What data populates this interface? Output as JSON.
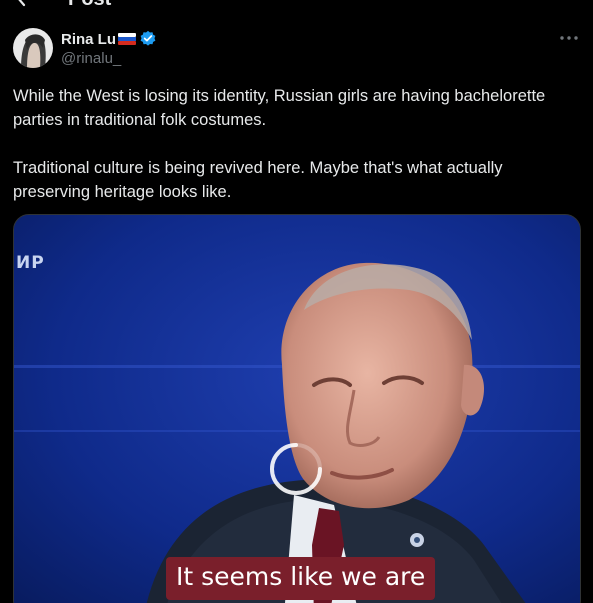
{
  "header": {
    "title": "Post"
  },
  "author": {
    "name": "Rina Lu",
    "handle": "@rinalu_",
    "flag_icon": "russia-flag-icon",
    "verified_icon": "verified-badge-icon"
  },
  "post": {
    "paragraphs": [
      "While the West is losing its identity, Russian girls are having bachelorette parties in traditional folk costumes.",
      "Traditional culture is being revived here. Maybe that's what actually preserving heritage looks like."
    ]
  },
  "media": {
    "channel_logo": "ИР",
    "caption": "It seems like we are",
    "state": "loading"
  },
  "colors": {
    "background": "#000000",
    "text": "#e7e9ea",
    "secondary_text": "#71767b",
    "verified": "#1d9bf0",
    "caption_bg": "#7a1f2b",
    "video_bg": "#0a1f6e"
  }
}
